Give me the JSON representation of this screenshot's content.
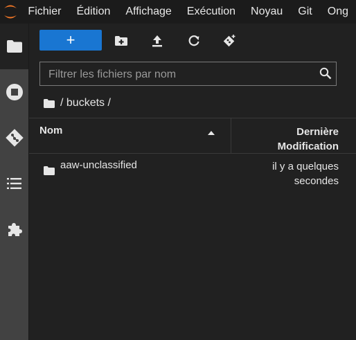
{
  "menubar": {
    "items": [
      "Fichier",
      "Édition",
      "Affichage",
      "Exécution",
      "Noyau",
      "Git",
      "Ong"
    ]
  },
  "sidebar": {
    "items": [
      {
        "name": "file-browser",
        "icon": "folder-icon",
        "active": true
      },
      {
        "name": "running",
        "icon": "stop-circle-icon",
        "active": false
      },
      {
        "name": "git",
        "icon": "git-icon",
        "active": false
      },
      {
        "name": "table-of-contents",
        "icon": "list-icon",
        "active": false
      },
      {
        "name": "extensions",
        "icon": "puzzle-icon",
        "active": false
      }
    ]
  },
  "toolbar": {
    "new_label": "+"
  },
  "search": {
    "placeholder": "Filtrer les fichiers par nom",
    "value": ""
  },
  "breadcrumb": {
    "path": "/ buckets /"
  },
  "table": {
    "columns": {
      "name": "Nom",
      "modified_line1": "Dernière",
      "modified_line2": "Modification"
    },
    "rows": [
      {
        "name": "aaw-unclassified",
        "modified_line1": "il y a quelques",
        "modified_line2": "secondes"
      }
    ]
  },
  "colors": {
    "accent": "#1976d2",
    "logo": "#f37726",
    "panel": "#212121",
    "sidebar": "#424242"
  }
}
